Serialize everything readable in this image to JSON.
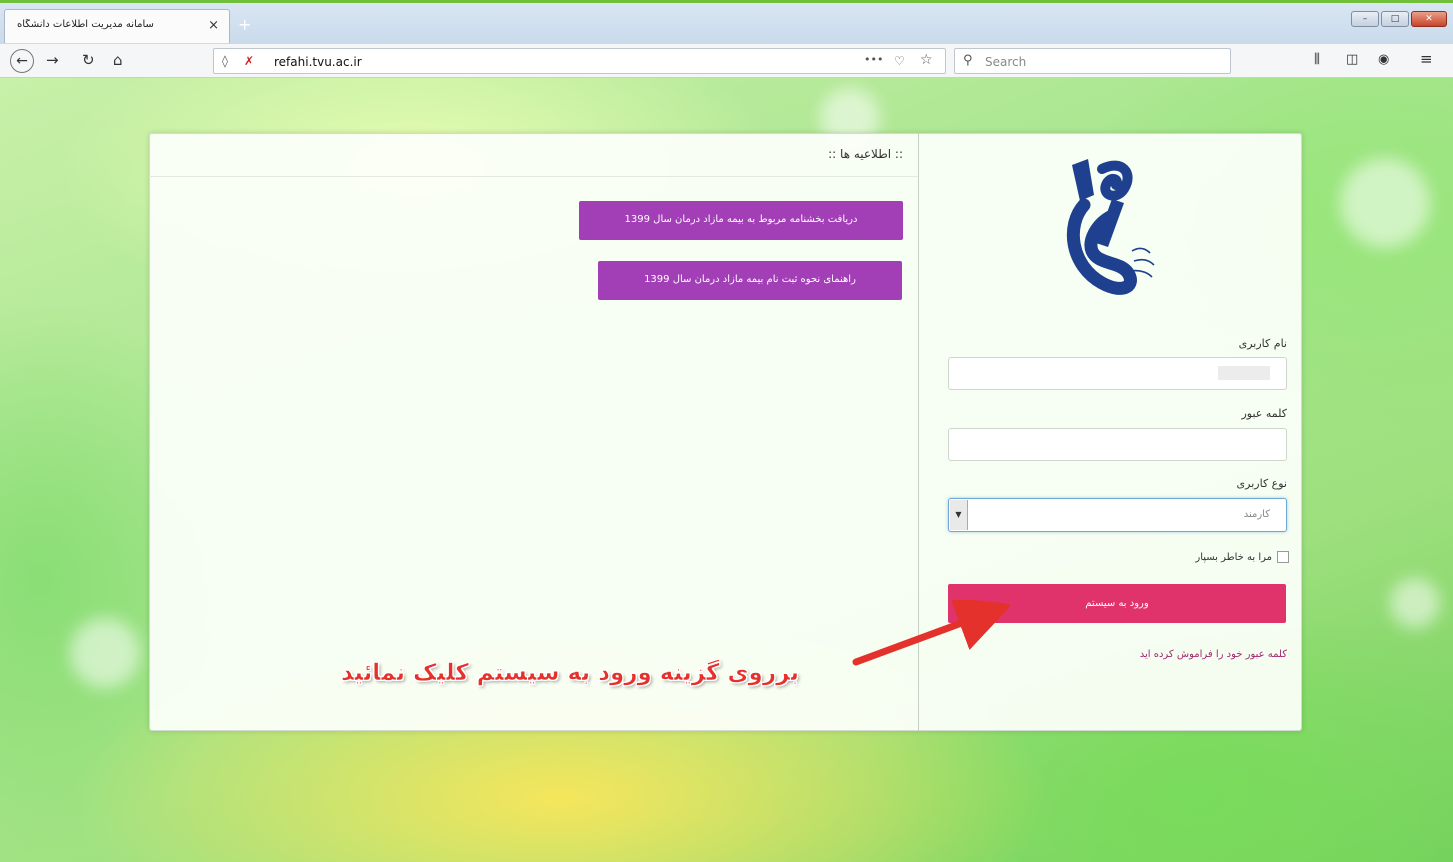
{
  "browser": {
    "tab_title": "سامانه مدیریت اطلاعات دانشگاه",
    "tab_close": "×",
    "new_tab": "+",
    "url": "refahi.tvu.ac.ir",
    "more_icon": "•••",
    "search_placeholder": "Search",
    "window_controls": {
      "minimize": "–",
      "maximize": "□",
      "close": "✕"
    }
  },
  "news": {
    "title": ":: اطلاعیه ها ::",
    "items": [
      {
        "label": "دریافت بخشنامه مربوط به بیمه مازاد درمان سال 1399"
      },
      {
        "label": "راهنمای نحوه ثبت نام بیمه مازاد درمان سال 1399"
      }
    ]
  },
  "login": {
    "username_label": "نام کاربری",
    "username_value": "",
    "password_label": "کلمه عبور",
    "password_value": "",
    "user_type_label": "نوع کاربری",
    "user_type_selected": "کارمند",
    "remember_label": "مرا به خاطر بسپار",
    "submit_label": "ورود به سیستم",
    "forgot_link": "کلمه عبور خود را فراموش کرده اید"
  },
  "annotation": {
    "text": "برروی گزینه ورود به سیستم کلیک نمائید"
  },
  "colors": {
    "notice_button": "#a33fb6",
    "login_button": "#e0336b",
    "annotation_text": "#e4312b",
    "logo_blue": "#1f3f8f"
  }
}
